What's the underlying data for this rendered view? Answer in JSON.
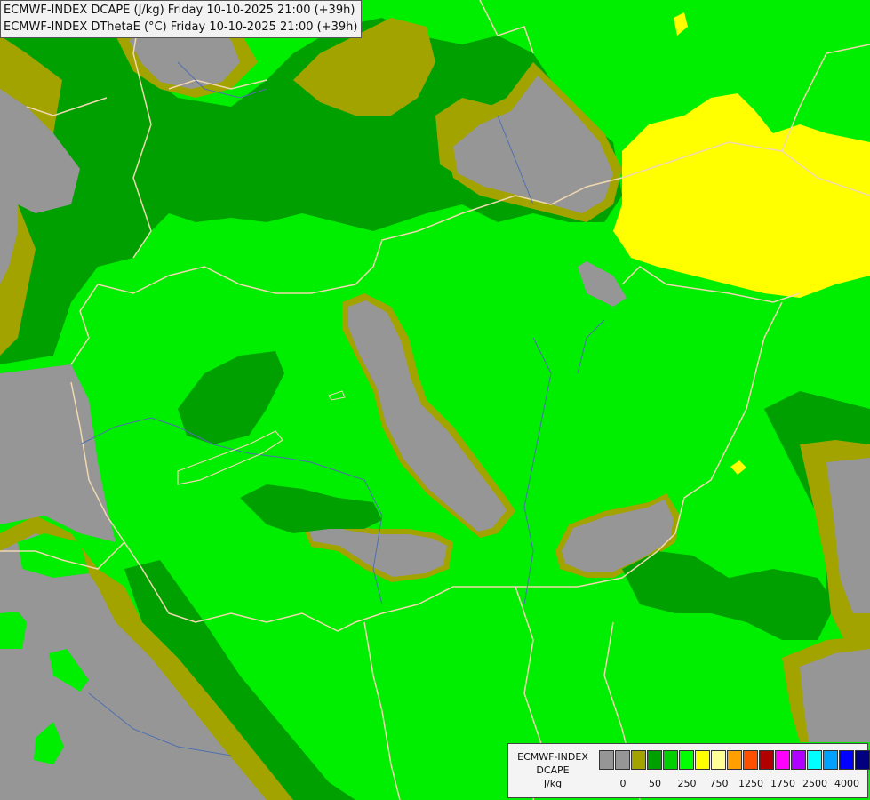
{
  "header": {
    "line1": "ECMWF-INDEX DCAPE (J/kg) Friday 10-10-2025 21:00 (+39h)",
    "line2": "ECMWF-INDEX DThetaE (°C) Friday 10-10-2025 21:00 (+39h)"
  },
  "legend": {
    "title_line1": "ECMWF-INDEX",
    "title_line2": "DCAPE",
    "unit": "J/kg",
    "swatch_colors": [
      "#969696",
      "#969696",
      "#a3a300",
      "#00a000",
      "#00d000",
      "#00ff00",
      "#ffff00",
      "#ffff96",
      "#ffa000",
      "#ff5000",
      "#b00000",
      "#ff00ff",
      "#b000ff",
      "#00ffff",
      "#00a0ff",
      "#0000ff",
      "#000080"
    ],
    "ticks": [
      "0",
      "50",
      "250",
      "750",
      "1250",
      "1750",
      "2500",
      "4000"
    ]
  },
  "colors": {
    "gray": "#969696",
    "olive": "#a3a300",
    "dark_green": "#00a000",
    "green": "#00ee00",
    "yellow": "#ffff00",
    "border": "#f0d8b0",
    "river": "#4f6fb0"
  }
}
